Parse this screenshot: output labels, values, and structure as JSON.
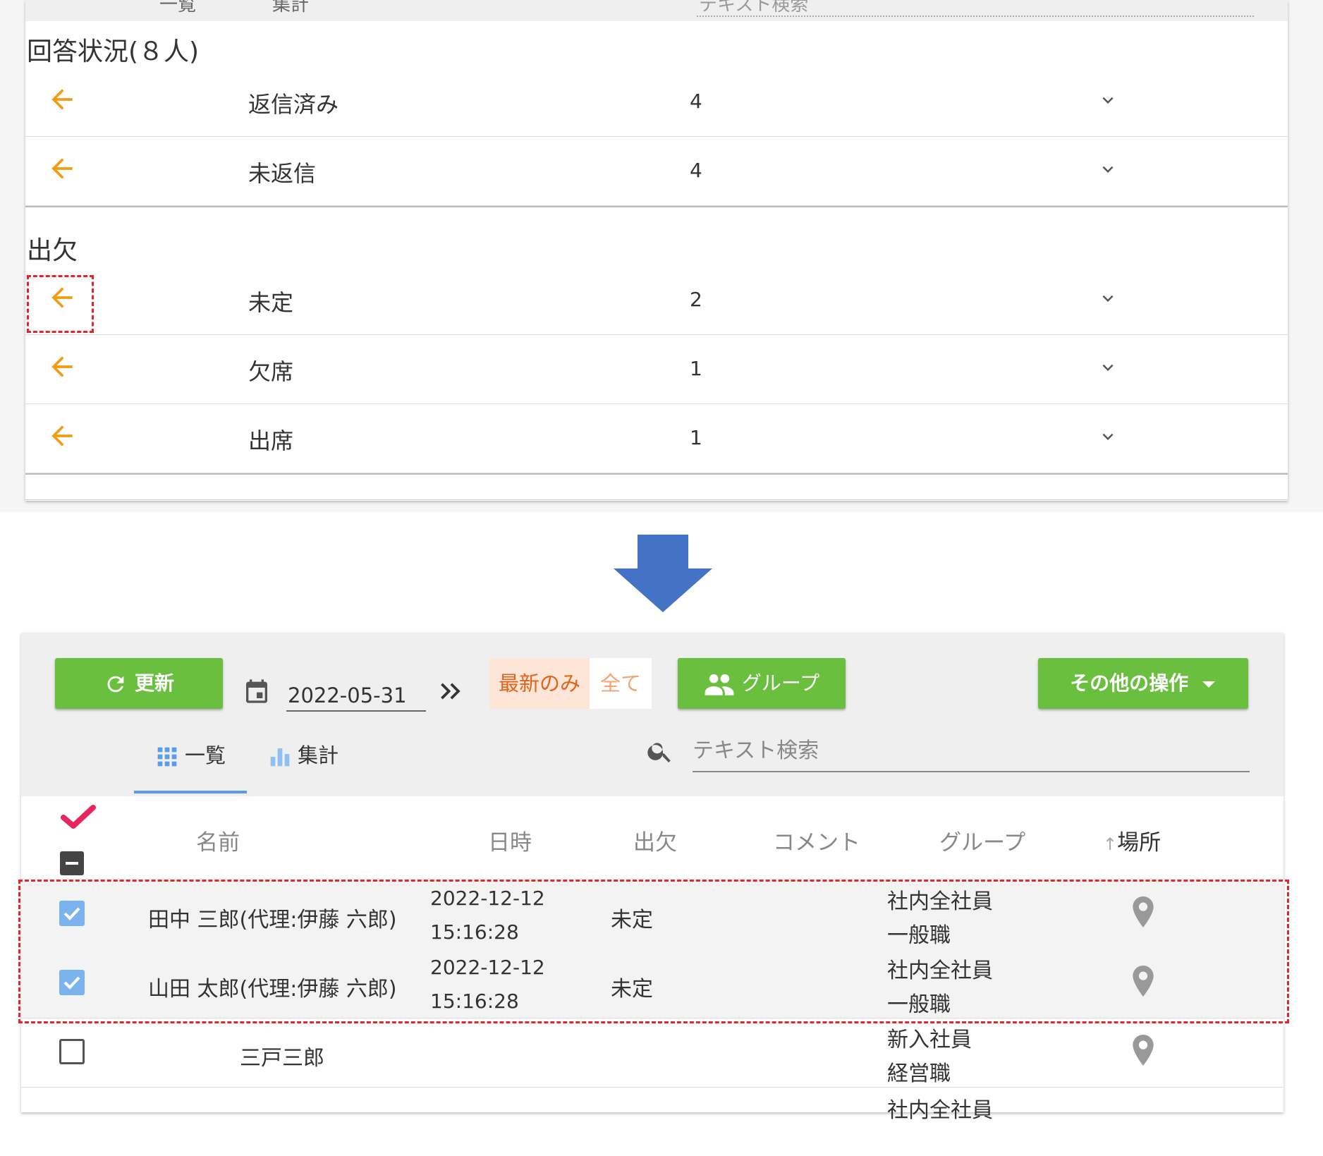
{
  "top_panel": {
    "cut_tab_1": "一覧",
    "cut_tab_2": "集計",
    "cut_search": "テキスト検索",
    "response_section": {
      "title": "回答状況(８人)",
      "rows": [
        {
          "label": "返信済み",
          "count": "4"
        },
        {
          "label": "未返信",
          "count": "4"
        }
      ]
    },
    "attendance_section": {
      "title": "出欠",
      "rows": [
        {
          "label": "未定",
          "count": "2"
        },
        {
          "label": "欠席",
          "count": "1"
        },
        {
          "label": "出席",
          "count": "1"
        }
      ]
    }
  },
  "toolbar": {
    "refresh_label": "更新",
    "date_value": "2022-05-31",
    "latest_only_label": "最新のみ",
    "all_label": "全て",
    "group_label": "グループ",
    "other_ops_label": "その他の操作",
    "tab_list_label": "一覧",
    "tab_summary_label": "集計",
    "search_placeholder": "テキスト検索"
  },
  "table": {
    "headers": {
      "name": "名前",
      "datetime": "日時",
      "attendance": "出欠",
      "comment": "コメント",
      "group": "グループ",
      "location": "場所"
    },
    "rows": [
      {
        "checked": true,
        "name": "田中 三郎(代理:伊藤 六郎)",
        "date": "2022-12-12",
        "time": "15:16:28",
        "attendance": "未定",
        "group_1": "社内全社員",
        "group_2": "一般職"
      },
      {
        "checked": true,
        "name": "山田 太郎(代理:伊藤 六郎)",
        "date": "2022-12-12",
        "time": "15:16:28",
        "attendance": "未定",
        "group_1": "社内全社員",
        "group_2": "一般職"
      },
      {
        "checked": false,
        "name": "三戸三郎",
        "date": "",
        "time": "",
        "attendance": "",
        "group_1": "新入社員",
        "group_2": "経営職"
      },
      {
        "checked": false,
        "name": "",
        "date": "",
        "time": "",
        "attendance": "",
        "group_1": "社内全社員",
        "group_2": ""
      }
    ]
  },
  "colors": {
    "accent_orange": "#f39c12",
    "button_green": "#6abf3f",
    "highlight_red": "#e5252a",
    "arrow_blue": "#4472c4",
    "check_pink": "#e8265e",
    "checkbox_blue": "#7ab3ee"
  }
}
